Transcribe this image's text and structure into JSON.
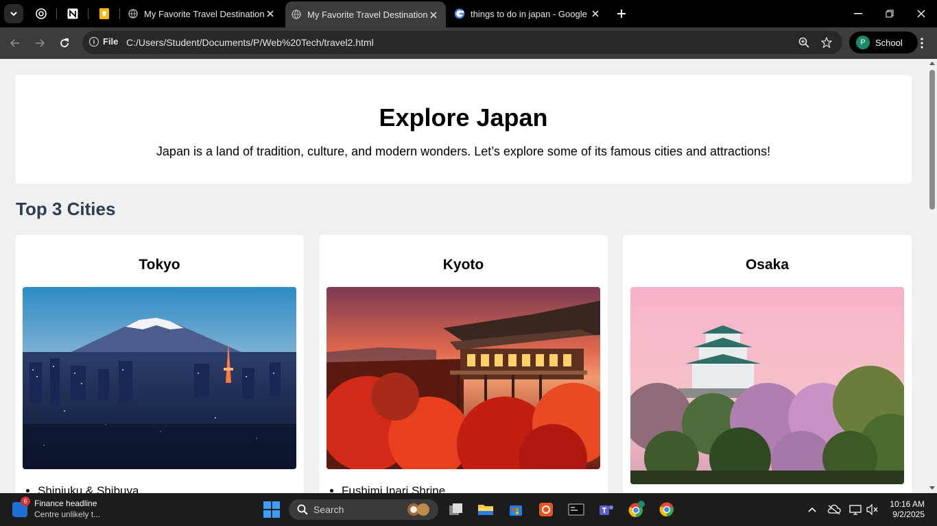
{
  "browser": {
    "tabs": [
      {
        "title": "My Favorite Travel Destination",
        "active": false
      },
      {
        "title": "My Favorite Travel Destination",
        "active": true
      },
      {
        "title": "things to do in japan - Google S",
        "active": false
      }
    ],
    "address": {
      "scheme_label": "File",
      "url": "C:/Users/Student/Documents/P/Web%20Tech/travel2.html"
    },
    "profile": {
      "initial": "P",
      "name": "School"
    }
  },
  "page": {
    "hero": {
      "title": "Explore Japan",
      "intro": "Japan is a land of tradition, culture, and modern wonders. Let’s explore some of its famous cities and attractions!"
    },
    "section_title": "Top 3 Cities",
    "cities": [
      {
        "name": "Tokyo",
        "first_item": "Shinjuku & Shibuya"
      },
      {
        "name": "Kyoto",
        "first_item": "Fushimi Inari Shrine"
      },
      {
        "name": "Osaka",
        "first_item": ""
      }
    ]
  },
  "taskbar": {
    "widget": {
      "badge": "6",
      "headline": "Finance headline",
      "subtext": "Centre unlikely t..."
    },
    "search_label": "Search",
    "time": "10:16 AM",
    "date": "9/2/2025"
  },
  "colors": {
    "accent_heading": "#2c3e50",
    "page_bg": "#f0f0f0"
  }
}
